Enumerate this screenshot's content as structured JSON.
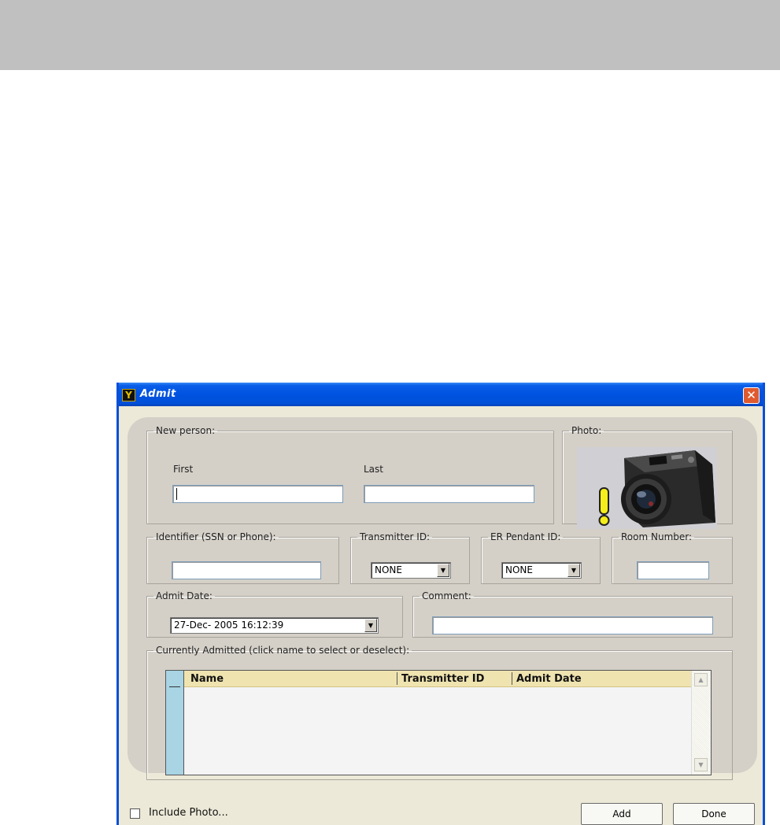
{
  "window": {
    "title": "Admit",
    "app_icon_glyph": "Y",
    "close_glyph": "✕",
    "titlebar_color": "#0053e0",
    "close_color": "#e05a2f"
  },
  "new_person": {
    "legend": "New person:",
    "first_label": "First",
    "last_label": "Last",
    "first_value": "",
    "last_value": ""
  },
  "photo": {
    "legend": "Photo:",
    "icon": "camera-warning-icon"
  },
  "identifier": {
    "legend": "Identifier (SSN or Phone):",
    "value": ""
  },
  "transmitter": {
    "legend": "Transmitter ID:",
    "value": "NONE"
  },
  "er_pendant": {
    "legend": "ER Pendant ID:",
    "value": "NONE"
  },
  "room": {
    "legend": "Room Number:",
    "value": ""
  },
  "admit_date": {
    "legend": "Admit Date:",
    "value": "27-Dec- 2005  16:12:39"
  },
  "comment": {
    "legend": "Comment:",
    "value": ""
  },
  "admitted": {
    "legend": "Currently Admitted (click name to select or deselect):",
    "columns": [
      "Name",
      "Transmitter ID",
      "Admit Date"
    ],
    "rows": [],
    "header_color": "#efe4b0",
    "rowhead_color": "#a8d4e4"
  },
  "footer": {
    "include_photo_label": "Include Photo...",
    "include_photo_checked": false,
    "add_label": "Add",
    "done_label": "Done"
  }
}
